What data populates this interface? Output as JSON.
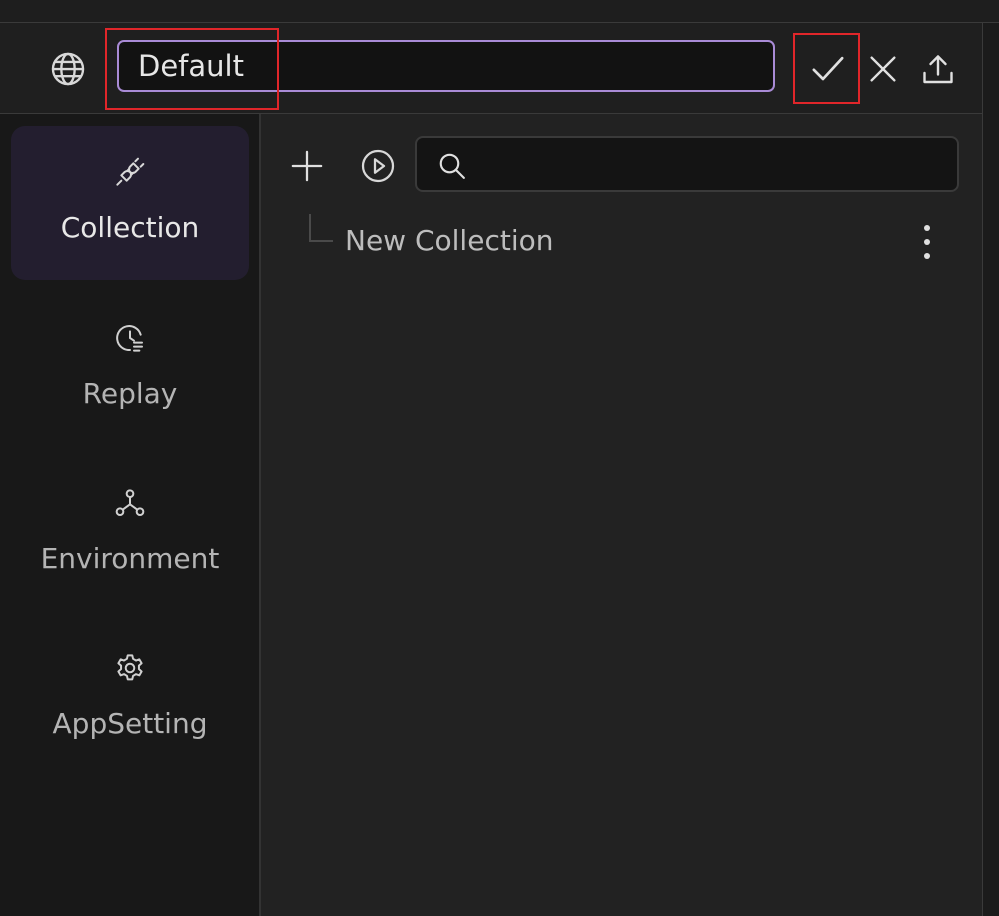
{
  "header": {
    "environment_name": "Default",
    "icons": {
      "globe": "globe-icon",
      "confirm": "check-icon",
      "close": "close-icon",
      "export": "upload-icon"
    }
  },
  "sidebar": {
    "items": [
      {
        "label": "Collection",
        "icon": "plug-icon",
        "active": true
      },
      {
        "label": "Replay",
        "icon": "history-icon",
        "active": false
      },
      {
        "label": "Environment",
        "icon": "network-icon",
        "active": false
      },
      {
        "label": "AppSetting",
        "icon": "gear-icon",
        "active": false
      }
    ]
  },
  "main": {
    "toolbar": {
      "add_icon": "plus-icon",
      "run_icon": "play-circle-icon",
      "search_value": "",
      "search_icon": "search-icon"
    },
    "tree": [
      {
        "label": "New Collection",
        "menu_icon": "more-vertical-icon"
      }
    ]
  },
  "colors": {
    "accent_border": "#a98bd6",
    "highlight": "#e0262a",
    "active_nav_bg": "#231e2f"
  }
}
